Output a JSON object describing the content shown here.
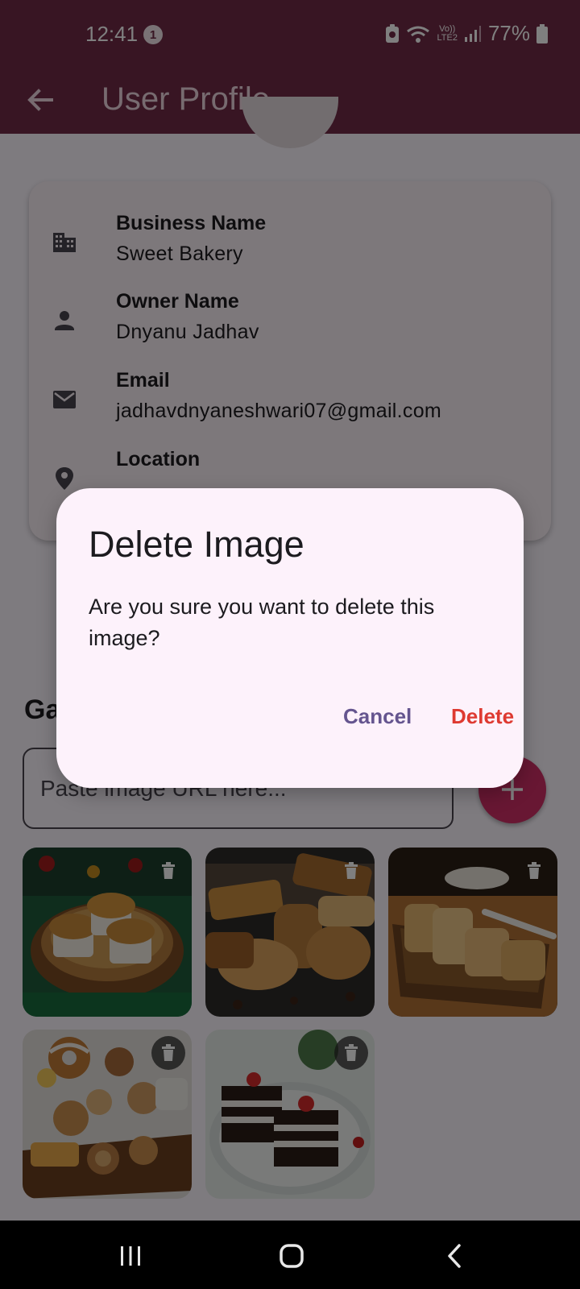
{
  "status_bar": {
    "time": "12:41",
    "notification_count": "1",
    "network_label": "LTE2",
    "battery_percent": "77%"
  },
  "app_bar": {
    "title": "User Profile",
    "back_icon": "arrow-left-icon"
  },
  "profile": {
    "fields": [
      {
        "icon": "building-icon",
        "label": "Business Name",
        "value": "Sweet Bakery"
      },
      {
        "icon": "person-icon",
        "label": "Owner Name",
        "value": "Dnyanu Jadhav"
      },
      {
        "icon": "email-icon",
        "label": "Email",
        "value": "jadhavdnyaneshwari07@gmail.com"
      },
      {
        "icon": "location-pin-icon",
        "label": "Location",
        "value": ""
      }
    ]
  },
  "gallery": {
    "heading": "Ga",
    "url_placeholder": "Paste image URL here...",
    "add_icon": "plus-icon",
    "images": [
      {
        "subject": "muffins on wooden tray",
        "delete_icon": "trash-icon"
      },
      {
        "subject": "assorted cookies",
        "delete_icon": "trash-icon"
      },
      {
        "subject": "bread in basket",
        "delete_icon": "trash-icon"
      },
      {
        "subject": "bakery assortment",
        "delete_icon": "trash-icon"
      },
      {
        "subject": "black forest pastries",
        "delete_icon": "trash-icon"
      }
    ]
  },
  "dialog": {
    "title": "Delete Image",
    "message": "Are you sure you want to delete this image?",
    "cancel_label": "Cancel",
    "delete_label": "Delete"
  },
  "colors": {
    "primary": "#702b47",
    "accent": "#d02f67",
    "dialog_bg": "#fdf2fb",
    "cancel_text": "#65558f",
    "delete_text": "#de3a31"
  },
  "nav": {
    "recents_icon": "recents-icon",
    "home_icon": "home-icon",
    "back_icon": "back-chevron-icon"
  }
}
